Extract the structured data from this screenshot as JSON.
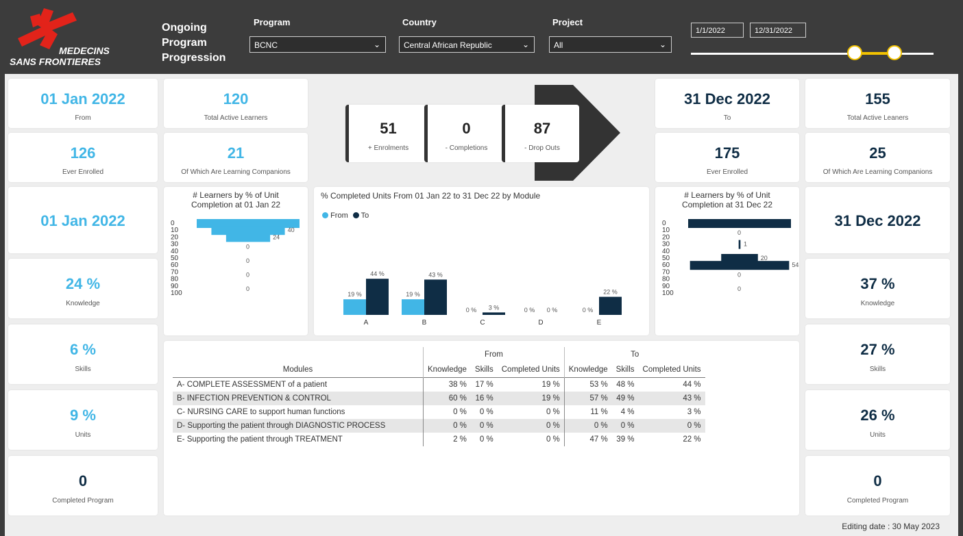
{
  "header": {
    "logo_line1": "MEDECINS",
    "logo_line2": "SANS FRONTIERES",
    "report_title_lines": [
      "Ongoing",
      "Program",
      "Progression"
    ],
    "filters": {
      "program": {
        "label": "Program",
        "value": "BCNC"
      },
      "country": {
        "label": "Country",
        "value": "Central African Republic"
      },
      "project": {
        "label": "Project",
        "value": "All"
      }
    },
    "date_start": "1/1/2022",
    "date_end": "12/31/2022"
  },
  "left": {
    "from_date": {
      "value": "01 Jan 2022",
      "label": "From"
    },
    "total_active": {
      "value": "120",
      "label": "Total Active Learners"
    },
    "ever_enrolled": {
      "value": "126",
      "label": "Ever Enrolled"
    },
    "companions": {
      "value": "21",
      "label": "Of Which Are Learning Companions"
    },
    "date2": "01 Jan 2022",
    "knowledge": {
      "value": "24 %",
      "label": "Knowledge"
    },
    "skills": {
      "value": "6 %",
      "label": "Skills"
    },
    "units": {
      "value": "9 %",
      "label": "Units"
    },
    "completed": {
      "value": "0",
      "label": "Completed Program"
    }
  },
  "right": {
    "to_date": {
      "value": "31 Dec 2022",
      "label": "To"
    },
    "total_active": {
      "value": "155",
      "label": "Total Active Leaners"
    },
    "ever_enrolled": {
      "value": "175",
      "label": "Ever Enrolled"
    },
    "companions": {
      "value": "25",
      "label": "Of Which Are Learning Companions"
    },
    "date2": "31 Dec 2022",
    "knowledge": {
      "value": "37 %",
      "label": "Knowledge"
    },
    "skills": {
      "value": "27 %",
      "label": "Skills"
    },
    "units": {
      "value": "26 %",
      "label": "Units"
    },
    "completed": {
      "value": "0",
      "label": "Completed Program"
    }
  },
  "flow": {
    "enrolments": {
      "value": "51",
      "label": "+ Enrolments"
    },
    "completions": {
      "value": "0",
      "label": "- Completions"
    },
    "dropouts": {
      "value": "87",
      "label": "- Drop Outs"
    }
  },
  "colors": {
    "cyan": "#41b6e6",
    "navy": "#0f2d45",
    "brand_red": "#e2231a"
  },
  "chart_data": [
    {
      "type": "bar",
      "orientation": "horizontal-centered",
      "title": "# Learners by % of Unit Completion at 01 Jan 22",
      "categories": [
        "0",
        "10",
        "20",
        "30",
        "40",
        "50",
        "60",
        "70",
        "80",
        "90",
        "100"
      ],
      "values": [
        56,
        40,
        24,
        0,
        null,
        0,
        null,
        0,
        null,
        0,
        null
      ],
      "labels": [
        "",
        "40",
        "24",
        "0",
        "",
        "0",
        "",
        "0",
        "",
        "0",
        ""
      ]
    },
    {
      "type": "bar",
      "title": "% Completed Units From 01 Jan 22 to 31 Dec 22 by Module",
      "legend": "top-left",
      "categories": [
        "A",
        "B",
        "C",
        "D",
        "E"
      ],
      "series": [
        {
          "name": "From",
          "values": [
            19,
            19,
            0,
            0,
            0
          ],
          "labels": [
            "19 %",
            "19 %",
            "0 %",
            "0 %",
            "0 %"
          ]
        },
        {
          "name": "To",
          "values": [
            44,
            43,
            3,
            0,
            22
          ],
          "labels": [
            "44 %",
            "43 %",
            "3 %",
            "0 %",
            "22 %"
          ]
        }
      ]
    },
    {
      "type": "bar",
      "orientation": "horizontal-centered",
      "title": "# Learners by % of Unit Completion at 31 Dec 22",
      "categories": [
        "0",
        "10",
        "20",
        "30",
        "40",
        "50",
        "60",
        "70",
        "80",
        "90",
        "100"
      ],
      "values": [
        56,
        0,
        null,
        1,
        null,
        20,
        54,
        0,
        null,
        0,
        null
      ],
      "labels": [
        "",
        "0",
        "",
        "1",
        "",
        "20",
        "54",
        "0",
        "",
        "0",
        ""
      ]
    }
  ],
  "table": {
    "group_from": "From",
    "group_to": "To",
    "headers": [
      "Modules",
      "Knowledge",
      "Skills",
      "Completed Units",
      "Knowledge",
      "Skills",
      "Completed Units"
    ],
    "rows": [
      [
        "A- COMPLETE ASSESSMENT of a patient",
        "38 %",
        "17 %",
        "19 %",
        "53 %",
        "48 %",
        "44 %"
      ],
      [
        "B- INFECTION PREVENTION & CONTROL",
        "60 %",
        "16 %",
        "19 %",
        "57 %",
        "49 %",
        "43 %"
      ],
      [
        "C- NURSING CARE to support human functions",
        "0 %",
        "0 %",
        "0 %",
        "11 %",
        "4 %",
        "3 %"
      ],
      [
        "D- Supporting the patient through DIAGNOSTIC PROCESS",
        "0 %",
        "0 %",
        "0 %",
        "0 %",
        "0 %",
        "0 %"
      ],
      [
        "E- Supporting the patient through TREATMENT",
        "2 %",
        "0 %",
        "0 %",
        "47 %",
        "39 %",
        "22 %"
      ]
    ]
  },
  "footer": {
    "editing_date": "Editing date :  30 May 2023"
  }
}
